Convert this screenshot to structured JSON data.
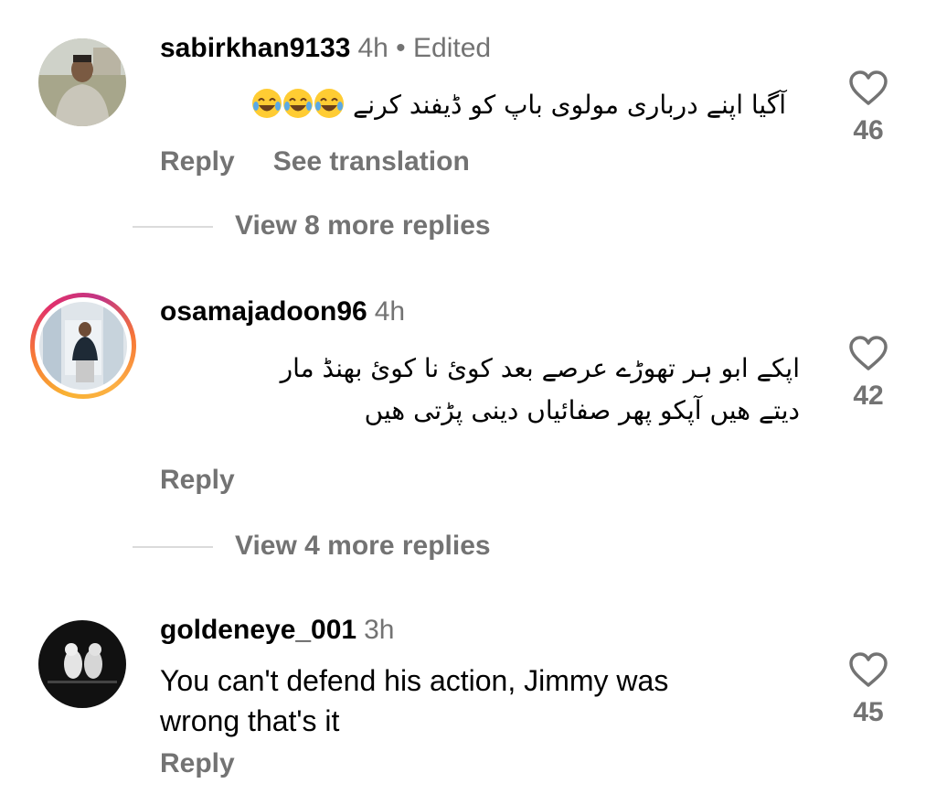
{
  "comments": [
    {
      "username": "sabirkhan9133",
      "meta": "4h • Edited",
      "text": "آگیا اپنے درباری مولوی باپ کو ڈیفند کرنے",
      "emoji": "😂😂😂",
      "likes": "46",
      "reply_label": "Reply",
      "translation_label": "See translation",
      "view_more": "View 8 more replies"
    },
    {
      "username": "osamajadoon96",
      "meta": "4h",
      "text_line1": "اپکے ابو ہر تھوڑے عرصے بعد کوئ نا کوئ بھنڈ مار",
      "text_line2": "دیتے ھیں آپکو پھر صفائیاں دینی پڑتی ھیں",
      "likes": "42",
      "reply_label": "Reply",
      "view_more": "View 4 more replies"
    },
    {
      "username": "goldeneye_001",
      "meta": "3h",
      "text_line1": "You can't defend his action, Jimmy was",
      "text_line2": "wrong that's it",
      "likes": "45",
      "reply_label": "Reply"
    }
  ],
  "icons": {
    "like": "heart-outline-icon",
    "emoji": "tears-of-joy-emoji"
  },
  "colors": {
    "secondary_text": "#737373",
    "story_ring_start": "#f9b233",
    "story_ring_end": "#e1306c"
  }
}
